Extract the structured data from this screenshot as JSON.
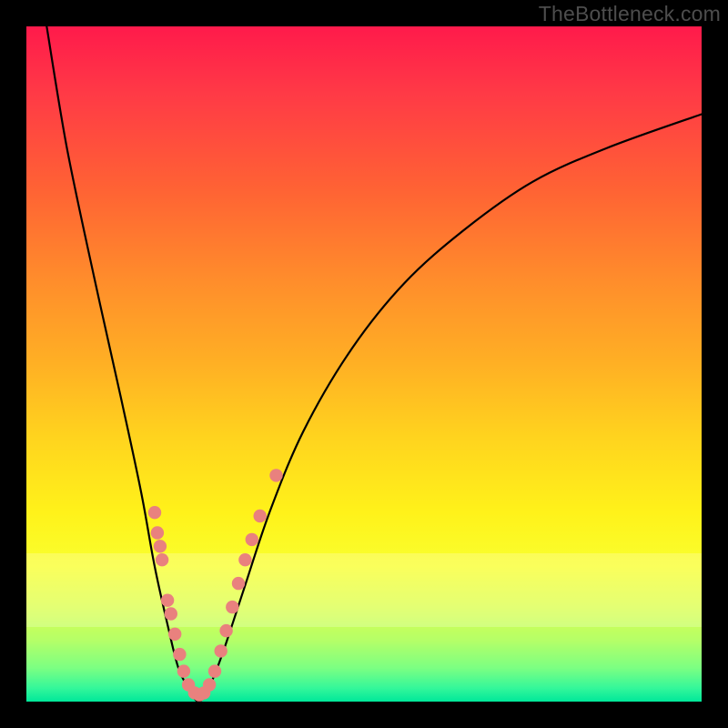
{
  "watermark": "TheBottleneck.com",
  "chart_data": {
    "type": "line",
    "title": "",
    "xlabel": "",
    "ylabel": "",
    "xlim": [
      0,
      100
    ],
    "ylim": [
      0,
      100
    ],
    "grid": false,
    "legend": false,
    "notes": "Qualitative bottleneck curve over a red→green vertical gradient. No numeric axis ticks or data labels are visible in the image; curve points below are read off pixel positions and normalized to 0–100 in each axis.",
    "series": [
      {
        "name": "bottleneck-curve",
        "x": [
          3,
          6,
          10,
          14,
          17,
          19,
          21,
          22.5,
          24,
          25.5,
          27,
          29,
          32,
          36,
          41,
          48,
          56,
          65,
          75,
          86,
          100
        ],
        "y": [
          100,
          82,
          63,
          45,
          31,
          20,
          11,
          5,
          2,
          0,
          2,
          7,
          16,
          28,
          40,
          52,
          62,
          70,
          77,
          82,
          87
        ]
      }
    ],
    "scatter_points": {
      "note": "Clusters of pink dots along the lower part of the V-curve; approximate normalized positions.",
      "color": "#e9817e",
      "points": [
        {
          "x": 19.0,
          "y": 28.0
        },
        {
          "x": 19.4,
          "y": 25.0
        },
        {
          "x": 19.8,
          "y": 23.0
        },
        {
          "x": 20.1,
          "y": 21.0
        },
        {
          "x": 20.9,
          "y": 15.0
        },
        {
          "x": 21.4,
          "y": 13.0
        },
        {
          "x": 22.0,
          "y": 10.0
        },
        {
          "x": 22.7,
          "y": 7.0
        },
        {
          "x": 23.3,
          "y": 4.5
        },
        {
          "x": 24.0,
          "y": 2.5
        },
        {
          "x": 24.9,
          "y": 1.3
        },
        {
          "x": 25.6,
          "y": 1.0
        },
        {
          "x": 26.3,
          "y": 1.3
        },
        {
          "x": 27.1,
          "y": 2.5
        },
        {
          "x": 27.9,
          "y": 4.5
        },
        {
          "x": 28.8,
          "y": 7.5
        },
        {
          "x": 29.6,
          "y": 10.5
        },
        {
          "x": 30.5,
          "y": 14.0
        },
        {
          "x": 31.4,
          "y": 17.5
        },
        {
          "x": 32.4,
          "y": 21.0
        },
        {
          "x": 33.4,
          "y": 24.0
        },
        {
          "x": 34.6,
          "y": 27.5
        },
        {
          "x": 37.0,
          "y": 33.5
        }
      ]
    },
    "gradient_stops": [
      {
        "pos": 0.0,
        "color": "#ff1a4b"
      },
      {
        "pos": 0.1,
        "color": "#ff3a46"
      },
      {
        "pos": 0.24,
        "color": "#ff6234"
      },
      {
        "pos": 0.38,
        "color": "#ff8e2b"
      },
      {
        "pos": 0.5,
        "color": "#ffb024"
      },
      {
        "pos": 0.61,
        "color": "#ffd41e"
      },
      {
        "pos": 0.72,
        "color": "#fff21a"
      },
      {
        "pos": 0.8,
        "color": "#f9ff2e"
      },
      {
        "pos": 0.86,
        "color": "#dcff4d"
      },
      {
        "pos": 0.91,
        "color": "#b4ff68"
      },
      {
        "pos": 0.95,
        "color": "#7cff82"
      },
      {
        "pos": 0.98,
        "color": "#34f79a"
      },
      {
        "pos": 1.0,
        "color": "#00e89a"
      }
    ],
    "pale_band": {
      "top_pct": 78,
      "bottom_pct": 89,
      "alpha": 0.22
    }
  }
}
